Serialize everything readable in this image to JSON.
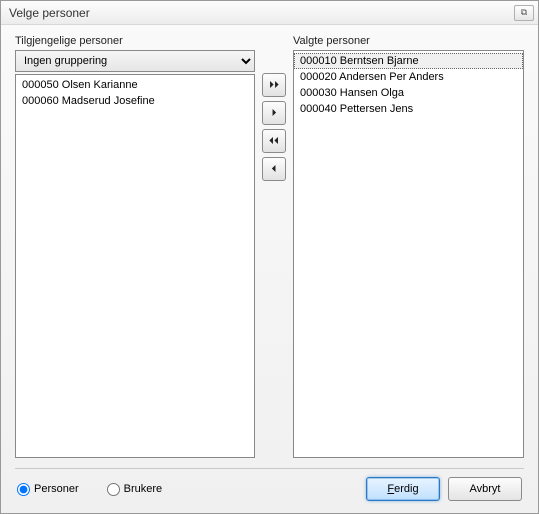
{
  "window": {
    "title": "Velge personer",
    "close_glyph": "⧉"
  },
  "available": {
    "label": "Tilgjengelige personer",
    "grouping_value": "Ingen gruppering",
    "items": [
      "000050 Olsen Karianne",
      "000060 Madserud Josefine"
    ]
  },
  "selected": {
    "label": "Valgte personer",
    "items": [
      "000010 Berntsen Bjarne",
      "000020 Andersen Per Anders",
      "000030 Hansen Olga",
      "000040 Pettersen Jens"
    ],
    "selected_index": 0
  },
  "move_buttons": {
    "add_all": "⏵⏵",
    "add_one": "⏵",
    "remove_all": "⏴⏴",
    "remove_one": "⏴"
  },
  "radios": {
    "personer": "Personer",
    "brukere": "Brukere",
    "checked": "personer"
  },
  "buttons": {
    "ok_prefix": "F",
    "ok_rest": "erdig",
    "cancel": "Avbryt"
  }
}
